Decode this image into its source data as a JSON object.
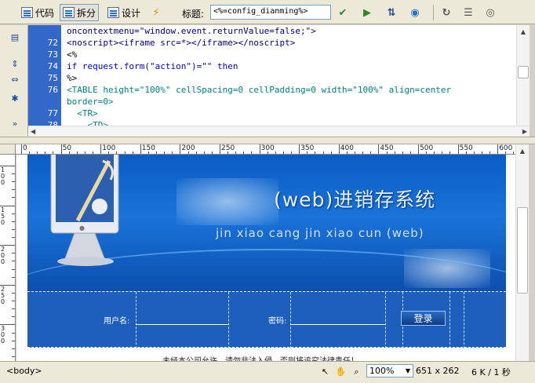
{
  "toolbar": {
    "code_label": "代码",
    "split_label": "拆分",
    "design_label": "设计",
    "title_label": "标题:",
    "title_value": "<%=config_dianming%>"
  },
  "code": {
    "lines": [
      {
        "num": "",
        "text": "oncontextmenu=\"window.event.returnValue=false;\">"
      },
      {
        "num": "72",
        "text": "<noscript><iframe src=*></iframe></noscript>"
      },
      {
        "num": "73",
        "text": "<%"
      },
      {
        "num": "74",
        "text": "if request.form(\"action\")=\"\" then"
      },
      {
        "num": "75",
        "text": "%>"
      },
      {
        "num": "76",
        "text": "<TABLE height=\"100%\" cellSpacing=0 cellPadding=0 width=\"100%\" align=center"
      },
      {
        "num": "",
        "text": "border=0>"
      },
      {
        "num": "77",
        "text": "  <TR>"
      },
      {
        "num": "78",
        "text": "    <TD>"
      }
    ]
  },
  "ruler": {
    "h_labels": [
      "0",
      "50",
      "100",
      "150",
      "200",
      "250",
      "300",
      "350",
      "400",
      "450",
      "500",
      "550",
      "600"
    ],
    "v_labels": [
      "100",
      "150",
      "200",
      "250",
      "300"
    ]
  },
  "banner": {
    "title": "(web)进销存系统",
    "subtitle": "jin xiao cang jin xiao cun (web)"
  },
  "login": {
    "username_label": "用户名:",
    "password_label": "密码:",
    "submit_label": "登录"
  },
  "footer_text": "未经本公司允许，请勿非法入侵，否则将追究法律责任！",
  "status": {
    "tag": "<body>",
    "zoom": "100%",
    "size": "651 x 262",
    "weight": "6 K / 1 秒"
  }
}
